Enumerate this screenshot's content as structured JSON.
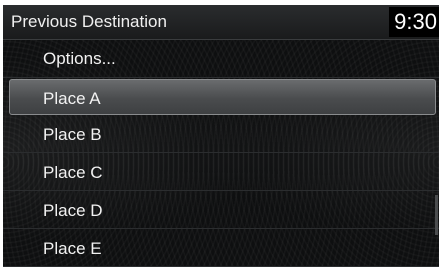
{
  "header": {
    "title": "Previous Destination",
    "clock": "9:30"
  },
  "menu": {
    "options_label": "Options...",
    "items": [
      {
        "label": "Place A",
        "selected": true
      },
      {
        "label": "Place B",
        "selected": false
      },
      {
        "label": "Place C",
        "selected": false
      },
      {
        "label": "Place D",
        "selected": false
      },
      {
        "label": "Place E",
        "selected": false
      }
    ]
  },
  "colors": {
    "background": "#0e0f10",
    "highlight": "#5a5c5e",
    "text": "#f2f2f2"
  }
}
